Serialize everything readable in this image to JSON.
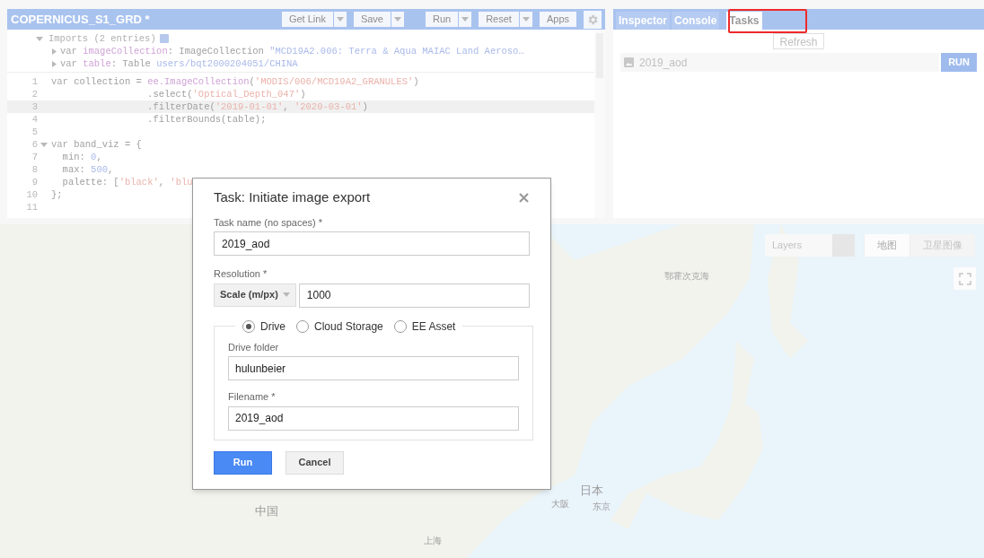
{
  "editor": {
    "title": "COPERNICUS_S1_GRD *",
    "toolbar": [
      {
        "label": "Get Link",
        "dropdown": true
      },
      {
        "label": "Save",
        "dropdown": true
      },
      {
        "label": "Run",
        "dropdown": true
      },
      {
        "label": "Reset",
        "dropdown": true
      },
      {
        "label": "Apps",
        "dropdown": false
      }
    ],
    "imports": {
      "label": "Imports (2 entries)",
      "entries": [
        {
          "tokens": [
            {
              "kind": "keyword",
              "text": "var"
            },
            {
              "kind": "fn",
              "text": " imageCollection"
            },
            {
              "kind": "plain",
              "text": ": ImageCollection "
            },
            {
              "kind": "number",
              "text": "\"MCD19A2.006: Terra & Aqua MAIAC Land Aeroso…"
            }
          ]
        },
        {
          "tokens": [
            {
              "kind": "keyword",
              "text": "var"
            },
            {
              "kind": "fn",
              "text": " table"
            },
            {
              "kind": "plain",
              "text": ": Table "
            },
            {
              "kind": "number",
              "text": "users/bqt2000204051/CHINA"
            }
          ]
        }
      ]
    },
    "lines": [
      {
        "number": "1",
        "current": false,
        "foldable": false,
        "tokens": [
          {
            "kind": "keyword",
            "text": "var"
          },
          {
            "kind": "plain",
            "text": " collection = "
          },
          {
            "kind": "fn",
            "text": "ee.ImageCollection"
          },
          {
            "kind": "plain",
            "text": "("
          },
          {
            "kind": "string",
            "text": "'MODIS/006/MCD19A2_GRANULES'"
          },
          {
            "kind": "plain",
            "text": ")"
          }
        ]
      },
      {
        "number": "2",
        "current": false,
        "foldable": false,
        "tokens": [
          {
            "kind": "plain",
            "text": "                 .select("
          },
          {
            "kind": "string",
            "text": "'Optical_Depth_047'"
          },
          {
            "kind": "plain",
            "text": ")"
          }
        ]
      },
      {
        "number": "3",
        "current": true,
        "foldable": false,
        "tokens": [
          {
            "kind": "plain",
            "text": "                 .filterDate("
          },
          {
            "kind": "string",
            "text": "'2019-01-01'"
          },
          {
            "kind": "plain",
            "text": ", "
          },
          {
            "kind": "string",
            "text": "'2020-03-01'"
          },
          {
            "kind": "plain",
            "text": ")"
          }
        ]
      },
      {
        "number": "4",
        "current": false,
        "foldable": false,
        "tokens": [
          {
            "kind": "plain",
            "text": "                 .filterBounds(table);"
          }
        ]
      },
      {
        "number": "5",
        "current": false,
        "foldable": false
      },
      {
        "number": "6",
        "current": false,
        "foldable": true,
        "tokens": [
          {
            "kind": "keyword",
            "text": "var"
          },
          {
            "kind": "plain",
            "text": " band_viz = {"
          }
        ]
      },
      {
        "number": "7",
        "current": false,
        "foldable": false,
        "tokens": [
          {
            "kind": "plain",
            "text": "  min: "
          },
          {
            "kind": "number",
            "text": "0"
          },
          {
            "kind": "plain",
            "text": ","
          }
        ]
      },
      {
        "number": "8",
        "current": false,
        "foldable": false,
        "tokens": [
          {
            "kind": "plain",
            "text": "  max: "
          },
          {
            "kind": "number",
            "text": "500"
          },
          {
            "kind": "plain",
            "text": ","
          }
        ]
      },
      {
        "number": "9",
        "current": false,
        "foldable": false,
        "tokens": [
          {
            "kind": "plain",
            "text": "  palette: ["
          },
          {
            "kind": "string",
            "text": "'black'"
          },
          {
            "kind": "plain",
            "text": ", "
          },
          {
            "kind": "string",
            "text": "'blu"
          }
        ]
      },
      {
        "number": "10",
        "current": false,
        "foldable": false,
        "tokens": [
          {
            "kind": "plain",
            "text": "};"
          }
        ]
      },
      {
        "number": "11",
        "current": false,
        "foldable": false
      }
    ]
  },
  "side_panel": {
    "tabs": [
      {
        "label": "Inspector",
        "selected": false
      },
      {
        "label": "Console",
        "selected": false
      },
      {
        "label": "Tasks",
        "selected": true
      }
    ],
    "refresh": "Refresh",
    "tasks": [
      {
        "name": "2019_aod",
        "action": "RUN"
      }
    ]
  },
  "map": {
    "layers": "Layers",
    "map_types": [
      {
        "label": "地图",
        "selected": true
      },
      {
        "label": "卫星图像",
        "selected": false
      }
    ],
    "labels": [
      {
        "text": "鄂霍次克海",
        "kind": "sea"
      },
      {
        "text": "中国",
        "kind": "country"
      },
      {
        "text": "日本",
        "kind": "country"
      },
      {
        "text": "大阪",
        "kind": "city"
      },
      {
        "text": "东京",
        "kind": "city"
      },
      {
        "text": "上海",
        "kind": "city"
      }
    ]
  },
  "dialog": {
    "title": "Task: Initiate image export",
    "task_name": {
      "label": "Task name (no spaces) *",
      "value": "2019_aod"
    },
    "resolution": {
      "label": "Resolution *",
      "unit": "Scale (m/px)",
      "value": "1000"
    },
    "destinations": [
      {
        "label": "Drive",
        "selected": true
      },
      {
        "label": "Cloud Storage",
        "selected": false
      },
      {
        "label": "EE Asset",
        "selected": false
      }
    ],
    "drive_folder": {
      "label": "Drive folder",
      "value": "hulunbeier"
    },
    "filename": {
      "label": "Filename *",
      "value": "2019_aod"
    },
    "buttons": [
      {
        "label": "Run",
        "kind": "primary"
      },
      {
        "label": "Cancel",
        "kind": "secondary"
      }
    ]
  }
}
